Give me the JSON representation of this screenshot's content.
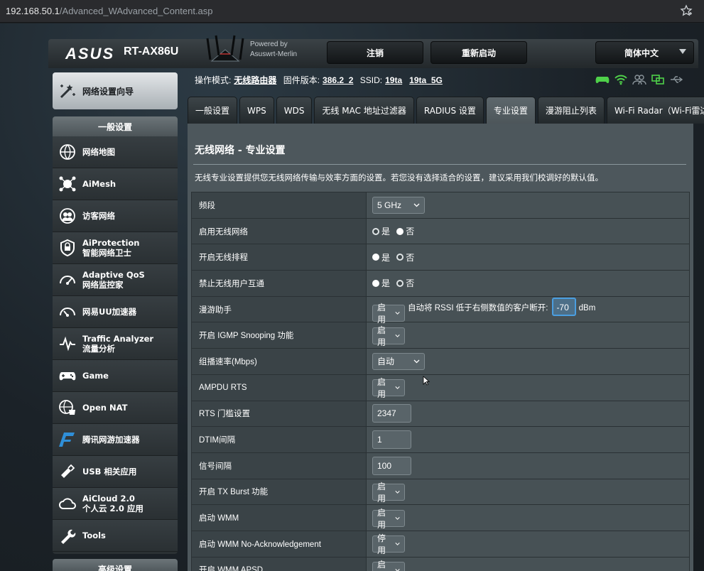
{
  "browser": {
    "url_host": "192.168.50.1",
    "url_path": "/Advanced_WAdvanced_Content.asp"
  },
  "header": {
    "logo": "ASUS",
    "model": "RT-AX86U",
    "powered_line1": "Powered by",
    "powered_line2": "Asuswrt-Merlin",
    "logout_label": "注销",
    "reboot_label": "重新启动",
    "language_label": "简体中文"
  },
  "status": {
    "mode_label": "操作模式:",
    "mode_value": "无线路由器",
    "firmware_label": "固件版本:",
    "firmware_value": "386.2_2",
    "ssid_label": "SSID:",
    "ssid_1": "19ta",
    "ssid_2": "19ta_5G"
  },
  "sidebar": {
    "quick_setup": "网络设置向导",
    "general_header": "一般设置",
    "items": [
      {
        "line1": "网络地图",
        "line2": ""
      },
      {
        "line1": "AiMesh",
        "line2": ""
      },
      {
        "line1": "访客网络",
        "line2": ""
      },
      {
        "line1": "AiProtection",
        "line2": "智能网络卫士"
      },
      {
        "line1": "Adaptive QoS",
        "line2": "网络监控家"
      },
      {
        "line1": "网易UU加速器",
        "line2": ""
      },
      {
        "line1": "Traffic Analyzer",
        "line2": "流量分析"
      },
      {
        "line1": "Game",
        "line2": ""
      },
      {
        "line1": "Open NAT",
        "line2": ""
      },
      {
        "line1": "腾讯网游加速器",
        "line2": ""
      },
      {
        "line1": "USB 相关应用",
        "line2": ""
      },
      {
        "line1": "AiCloud 2.0",
        "line2": "个人云 2.0 应用"
      },
      {
        "line1": "Tools",
        "line2": ""
      }
    ],
    "advanced_header": "高级设置"
  },
  "tabs": [
    "一般设置",
    "WPS",
    "WDS",
    "无线 MAC 地址过滤器",
    "RADIUS 设置",
    "专业设置",
    "漫游阻止列表",
    "Wi-Fi Radar（Wi-Fi雷达）"
  ],
  "main": {
    "title": "无线网络 - 专业设置",
    "description": "无线专业设置提供您无线网络传输与效率方面的设置。若您没有选择适合的设置，建议采用我们校调好的默认值。",
    "yes": "是",
    "no": "否",
    "rows": {
      "band": {
        "label": "频段",
        "value": "5  GHz"
      },
      "enable_radio": {
        "label": "启用无线网络",
        "selected": "yes"
      },
      "enable_schedule": {
        "label": "开启无线排程",
        "selected": "no"
      },
      "ap_isolated": {
        "label": "禁止无线用户互通",
        "selected": "no"
      },
      "roaming": {
        "label": "漫游助手",
        "value": "启用",
        "text": "自动将 RSSI 低于右侧数值的客户断开:",
        "rssi": "-70",
        "unit": "dBm"
      },
      "igmp": {
        "label": "开启 IGMP Snooping 功能",
        "value": "启用"
      },
      "multicast": {
        "label": "组播速率(Mbps)",
        "value": "自动"
      },
      "ampdu": {
        "label": "AMPDU RTS",
        "value": "启用"
      },
      "rts": {
        "label": "RTS 门槛设置",
        "value": "2347"
      },
      "dtim": {
        "label": "DTIM间隔",
        "value": "1"
      },
      "beacon": {
        "label": "信号间隔",
        "value": "100"
      },
      "txburst": {
        "label": "开启 TX Burst 功能",
        "value": "启用"
      },
      "wmm": {
        "label": "启动 WMM",
        "value": "启用"
      },
      "wmm_noack": {
        "label": "启动 WMM No-Acknowledgement",
        "value": "停用"
      },
      "wmm_apsd": {
        "label": "开启 WMM APSD",
        "value": "启用"
      }
    }
  }
}
